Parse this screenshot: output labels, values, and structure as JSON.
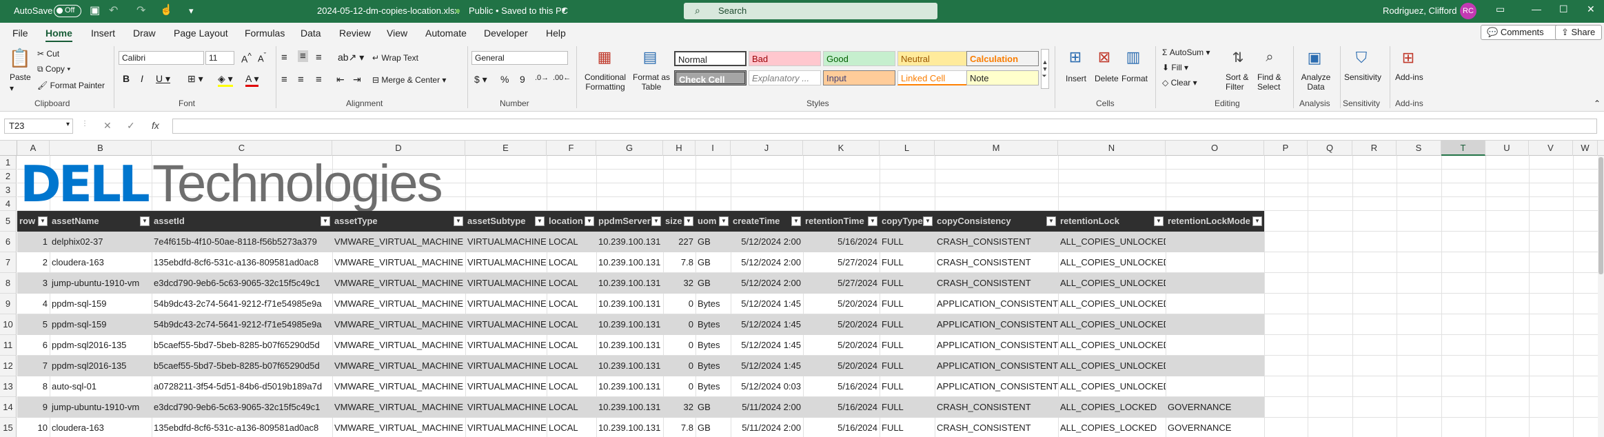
{
  "titlebar": {
    "autosave": "AutoSave",
    "toggle": "Off",
    "filename": "2024-05-12-dm-copies-location.xlsx",
    "status": "Public • Saved to this PC",
    "search_placeholder": "Search",
    "user": "Rodriguez, Clifford",
    "initials": "RC"
  },
  "menu": {
    "items": [
      "File",
      "Home",
      "Insert",
      "Draw",
      "Page Layout",
      "Formulas",
      "Data",
      "Review",
      "View",
      "Automate",
      "Developer",
      "Help"
    ],
    "active": "Home",
    "comments": "Comments",
    "share": "Share"
  },
  "ribbon": {
    "clipboard": {
      "paste": "Paste",
      "cut": "Cut",
      "copy": "Copy",
      "format_painter": "Format Painter",
      "label": "Clipboard"
    },
    "font": {
      "name": "Calibri",
      "size": "11",
      "label": "Font"
    },
    "alignment": {
      "wrap": "Wrap Text",
      "merge": "Merge & Center",
      "label": "Alignment"
    },
    "number": {
      "format": "General",
      "label": "Number"
    },
    "styles": {
      "conditional": "Conditional Formatting",
      "format_table": "Format as Table",
      "cells": [
        "Normal",
        "Bad",
        "Good",
        "Neutral",
        "Calculation",
        "Check Cell",
        "Explanatory ...",
        "Input",
        "Linked Cell",
        "Note"
      ],
      "label": "Styles"
    },
    "cells": {
      "insert": "Insert",
      "delete": "Delete",
      "format": "Format",
      "label": "Cells"
    },
    "editing": {
      "autosum": "AutoSum",
      "fill": "Fill",
      "clear": "Clear",
      "sort": "Sort & Filter",
      "find": "Find & Select",
      "label": "Editing"
    },
    "analysis": {
      "analyze": "Analyze Data",
      "label": "Analysis"
    },
    "sensitivity": {
      "name": "Sensitivity",
      "label": "Sensitivity"
    },
    "addins": {
      "name": "Add-ins",
      "label": "Add-ins"
    }
  },
  "formula": {
    "cell": "T23",
    "fx": "fx",
    "value": ""
  },
  "columns": [
    "A",
    "B",
    "C",
    "D",
    "E",
    "F",
    "G",
    "H",
    "I",
    "J",
    "K",
    "L",
    "M",
    "N",
    "O",
    "P",
    "Q",
    "R",
    "S",
    "T",
    "U",
    "V",
    "W"
  ],
  "row_numbers": [
    "1",
    "2",
    "3",
    "4",
    "5",
    "6",
    "7",
    "8",
    "9",
    "10",
    "11",
    "12",
    "13",
    "14",
    "15"
  ],
  "logo": {
    "brand": "DELL",
    "product": "Technologies"
  },
  "table": {
    "headers": [
      "row",
      "assetName",
      "assetId",
      "assetType",
      "assetSubtype",
      "location",
      "ppdmServer",
      "size",
      "uom",
      "createTime",
      "retentionTime",
      "copyType",
      "copyConsistency",
      "retentionLock",
      "retentionLockMode"
    ],
    "rows": [
      [
        "1",
        "delphix02-37",
        "7e4f615b-4f10-50ae-8118-f56b5273a379",
        "VMWARE_VIRTUAL_MACHINE",
        "VIRTUALMACHINE",
        "LOCAL",
        "10.239.100.131",
        "227",
        "GB",
        "5/12/2024 2:00",
        "5/16/2024",
        "FULL",
        "CRASH_CONSISTENT",
        "ALL_COPIES_UNLOCKED",
        ""
      ],
      [
        "2",
        "cloudera-163",
        "135ebdfd-8cf6-531c-a136-809581ad0ac8",
        "VMWARE_VIRTUAL_MACHINE",
        "VIRTUALMACHINE",
        "LOCAL",
        "10.239.100.131",
        "7.8",
        "GB",
        "5/12/2024 2:00",
        "5/27/2024",
        "FULL",
        "CRASH_CONSISTENT",
        "ALL_COPIES_UNLOCKED",
        ""
      ],
      [
        "3",
        "jump-ubuntu-1910-vm",
        "e3dcd790-9eb6-5c63-9065-32c15f5c49c1",
        "VMWARE_VIRTUAL_MACHINE",
        "VIRTUALMACHINE",
        "LOCAL",
        "10.239.100.131",
        "32",
        "GB",
        "5/12/2024 2:00",
        "5/27/2024",
        "FULL",
        "CRASH_CONSISTENT",
        "ALL_COPIES_UNLOCKED",
        ""
      ],
      [
        "4",
        "ppdm-sql-159",
        "54b9dc43-2c74-5641-9212-f71e54985e9a",
        "VMWARE_VIRTUAL_MACHINE",
        "VIRTUALMACHINE",
        "LOCAL",
        "10.239.100.131",
        "0",
        "Bytes",
        "5/12/2024 1:45",
        "5/20/2024",
        "FULL",
        "APPLICATION_CONSISTENT",
        "ALL_COPIES_UNLOCKED",
        ""
      ],
      [
        "5",
        "ppdm-sql-159",
        "54b9dc43-2c74-5641-9212-f71e54985e9a",
        "VMWARE_VIRTUAL_MACHINE",
        "VIRTUALMACHINE",
        "LOCAL",
        "10.239.100.131",
        "0",
        "Bytes",
        "5/12/2024 1:45",
        "5/20/2024",
        "FULL",
        "APPLICATION_CONSISTENT",
        "ALL_COPIES_UNLOCKED",
        ""
      ],
      [
        "6",
        "ppdm-sql2016-135",
        "b5caef55-5bd7-5beb-8285-b07f65290d5d",
        "VMWARE_VIRTUAL_MACHINE",
        "VIRTUALMACHINE",
        "LOCAL",
        "10.239.100.131",
        "0",
        "Bytes",
        "5/12/2024 1:45",
        "5/20/2024",
        "FULL",
        "APPLICATION_CONSISTENT",
        "ALL_COPIES_UNLOCKED",
        ""
      ],
      [
        "7",
        "ppdm-sql2016-135",
        "b5caef55-5bd7-5beb-8285-b07f65290d5d",
        "VMWARE_VIRTUAL_MACHINE",
        "VIRTUALMACHINE",
        "LOCAL",
        "10.239.100.131",
        "0",
        "Bytes",
        "5/12/2024 1:45",
        "5/20/2024",
        "FULL",
        "APPLICATION_CONSISTENT",
        "ALL_COPIES_UNLOCKED",
        ""
      ],
      [
        "8",
        "auto-sql-01",
        "a0728211-3f54-5d51-84b6-d5019b189a7d",
        "VMWARE_VIRTUAL_MACHINE",
        "VIRTUALMACHINE",
        "LOCAL",
        "10.239.100.131",
        "0",
        "Bytes",
        "5/12/2024 0:03",
        "5/16/2024",
        "FULL",
        "APPLICATION_CONSISTENT",
        "ALL_COPIES_UNLOCKED",
        ""
      ],
      [
        "9",
        "jump-ubuntu-1910-vm",
        "e3dcd790-9eb6-5c63-9065-32c15f5c49c1",
        "VMWARE_VIRTUAL_MACHINE",
        "VIRTUALMACHINE",
        "LOCAL",
        "10.239.100.131",
        "32",
        "GB",
        "5/11/2024 2:00",
        "5/16/2024",
        "FULL",
        "CRASH_CONSISTENT",
        "ALL_COPIES_LOCKED",
        "GOVERNANCE"
      ],
      [
        "10",
        "cloudera-163",
        "135ebdfd-8cf6-531c-a136-809581ad0ac8",
        "VMWARE_VIRTUAL_MACHINE",
        "VIRTUALMACHINE",
        "LOCAL",
        "10.239.100.131",
        "7.8",
        "GB",
        "5/11/2024 2:00",
        "5/16/2024",
        "FULL",
        "CRASH_CONSISTENT",
        "ALL_COPIES_LOCKED",
        "GOVERNANCE"
      ]
    ]
  },
  "colors": {
    "excel_green": "#217346",
    "header_bg": "#2f2f2f",
    "row_alt": "#d9d9d9"
  }
}
